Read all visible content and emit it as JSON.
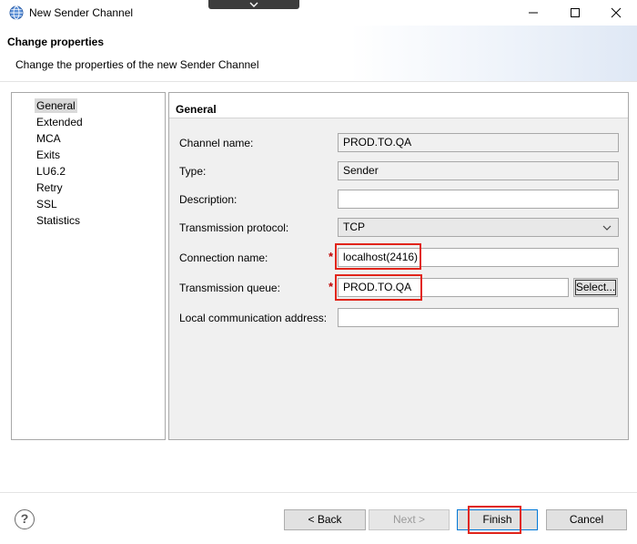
{
  "window": {
    "title": "New Sender Channel"
  },
  "header": {
    "title": "Change properties",
    "description": "Change the properties of the new Sender Channel"
  },
  "nav": {
    "items": [
      "General",
      "Extended",
      "MCA",
      "Exits",
      "LU6.2",
      "Retry",
      "SSL",
      "Statistics"
    ],
    "selected": "General"
  },
  "section": {
    "title": "General"
  },
  "fields": {
    "channel_name": {
      "label": "Channel name:",
      "value": "PROD.TO.QA"
    },
    "type": {
      "label": "Type:",
      "value": "Sender"
    },
    "description": {
      "label": "Description:",
      "value": ""
    },
    "transmission_protocol": {
      "label": "Transmission protocol:",
      "value": "TCP"
    },
    "connection_name": {
      "label": "Connection name:",
      "value": "localhost(2416)"
    },
    "transmission_queue": {
      "label": "Transmission queue:",
      "value": "PROD.TO.QA"
    },
    "local_address": {
      "label": "Local communication address:",
      "value": ""
    }
  },
  "required_marker": "*",
  "select_button": {
    "label": "Select..."
  },
  "buttons": {
    "help": "?",
    "back": "< Back",
    "next": "Next >",
    "finish": "Finish",
    "cancel": "Cancel"
  },
  "colors": {
    "highlight": "#e1251b",
    "required": "#c00000",
    "focus": "#0078d7"
  },
  "icons": {
    "app": "globe-icon",
    "collapse": "chevron-down-icon",
    "minimize": "minimize-icon",
    "maximize": "maximize-icon",
    "close": "close-icon",
    "dropdown": "chevron-down-icon"
  }
}
